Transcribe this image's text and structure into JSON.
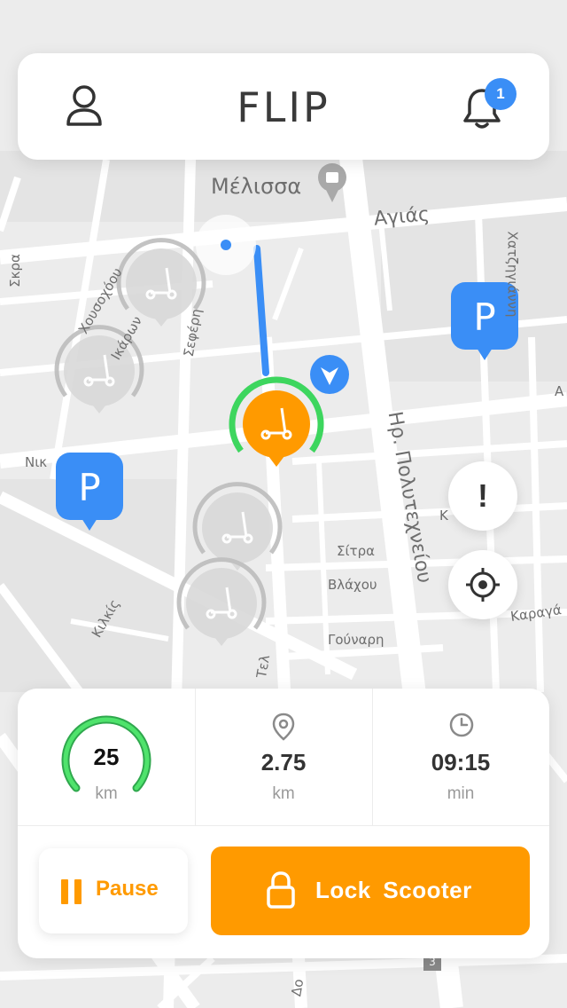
{
  "app": {
    "logo_text": "FLIP",
    "brand_color": "#ff9a00",
    "accent_blue": "#3a8ef6"
  },
  "header": {
    "profile_icon": "user-icon",
    "bell_icon": "bell-icon",
    "notification_count": "1"
  },
  "map": {
    "streets": [
      "Μέλισσα",
      "Αγιάς",
      "Χατζηγιάννη",
      "Σκρα",
      "Χουσοχόου",
      "Ικάρων",
      "Σεφέρη",
      "Ηρ. Πολυτεχνείου",
      "Νικ",
      "Κ",
      "Α",
      "Σίτρα",
      "Βλάχου",
      "Γούναρη",
      "Καραγά",
      "Κιλκίς",
      "Τελ",
      "Δο",
      "3"
    ],
    "parking_label": "P"
  },
  "controls": {
    "alert_symbol": "!",
    "locate_icon": "crosshair-icon"
  },
  "ride": {
    "battery": {
      "value": "25",
      "unit": "km",
      "level": 0.75
    },
    "distance": {
      "value": "2.75",
      "unit": "km",
      "icon": "pin-icon"
    },
    "time": {
      "value": "09:15",
      "unit": "min",
      "icon": "clock-icon"
    }
  },
  "actions": {
    "pause_label": "Pause",
    "lock_label": "Lock Scooter"
  }
}
